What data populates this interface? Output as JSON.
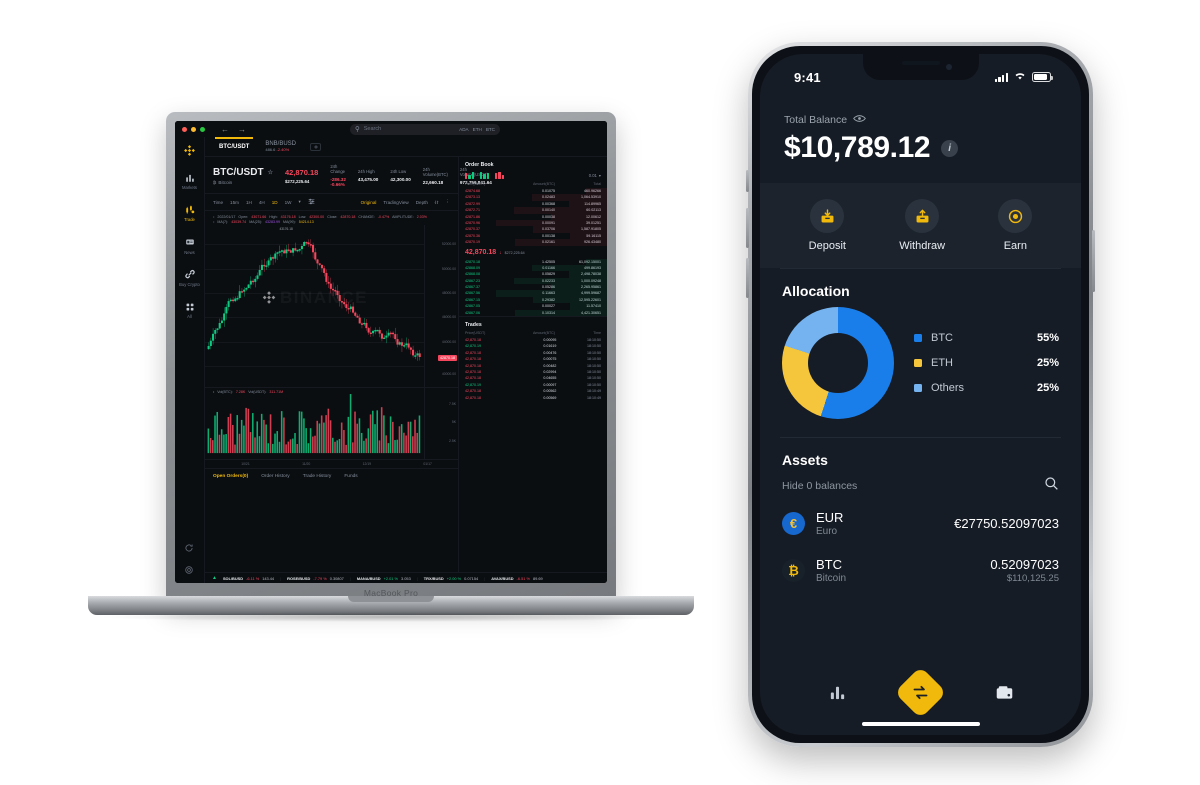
{
  "laptop": {
    "model_label": "MacBook Pro",
    "search": {
      "placeholder": "Search",
      "chips": [
        "ADA",
        "ETH",
        "BTC"
      ]
    },
    "sidebar": {
      "items": [
        {
          "label": "Markets",
          "icon": "bar-chart-icon",
          "active": false
        },
        {
          "label": "Trade",
          "icon": "candlestick-icon",
          "active": true
        },
        {
          "label": "News",
          "icon": "news-icon",
          "active": false
        },
        {
          "label": "Buy\nCrypto",
          "icon": "link-icon",
          "active": false
        },
        {
          "label": "All",
          "icon": "grid-icon",
          "active": false
        }
      ],
      "bottom": [
        {
          "icon": "refresh-icon"
        },
        {
          "icon": "gear-icon"
        }
      ]
    },
    "pair_tabs": [
      {
        "name": "BTC/USDT",
        "sub": "",
        "sub_change": "",
        "active": true
      },
      {
        "name": "BNB/BUSD",
        "sub": "486.6",
        "sub_change": "-2.40%",
        "active": false
      }
    ],
    "ticker": {
      "pair": "BTC/USDT",
      "coin_label": "Bitcoin",
      "last_price": "42,870.18",
      "last_price_usd": "$272,225.64",
      "stats": [
        {
          "label": "24h Change",
          "value": "-286.32 -0.66%",
          "negative": true
        },
        {
          "label": "24h High",
          "value": "43,475.00",
          "negative": false
        },
        {
          "label": "24h Low",
          "value": "42,300.00",
          "negative": false
        },
        {
          "label": "24h Volume(BTC)",
          "value": "22,660.18",
          "negative": false
        },
        {
          "label": "24h Volume(USDT)",
          "value": "972,756,841.64",
          "negative": false
        }
      ]
    },
    "chart": {
      "timeframes": [
        "Time",
        "15m",
        "1H",
        "4H",
        "1D",
        "1W"
      ],
      "active_timeframe": "1D",
      "view_modes": [
        "Original",
        "TradingView",
        "Depth"
      ],
      "active_view": "Original",
      "ohlc_line": {
        "date": "2022/01/17",
        "open_label": "Open:",
        "open": "43071.66",
        "high_label": "High:",
        "high": "43176.18",
        "low_label": "Low:",
        "low": "42300.00",
        "close_label": "Close:",
        "close": "42870.18",
        "change_label": "CHANGE:",
        "change": "-0.47%",
        "amplitude_label": "AMPLITUDE:",
        "amplitude": "2.03%"
      },
      "ma_line": {
        "ma7_label": "MA(7):",
        "ma7": "43039.74",
        "ma25_label": "MA(25):",
        "ma25": "43283.99",
        "ma99_label": "MA(99):",
        "ma99": "54214.13"
      },
      "high_marker": "43176.18",
      "y_ticks": [
        "52000.00",
        "50000.00",
        "48000.00",
        "46000.00",
        "44000.00",
        "42000.00",
        "40000.00"
      ],
      "price_badge": "42870.18",
      "x_ticks": [
        "10/21",
        "11/20",
        "12/19",
        "01/17"
      ],
      "volume_header": {
        "vol_btc_label": "Vol(BTC):",
        "vol_btc": "7.28K",
        "vol_usdt_label": "Vol(USDT):",
        "vol_usdt": "311.71M"
      },
      "volume_y_ticks": [
        "7.5K",
        "5K",
        "2.5K"
      ]
    },
    "order_book": {
      "title": "Order Book",
      "tick_size": "0.01",
      "columns": [
        "Price(USDT)",
        "Amount(BTC)",
        "Total"
      ],
      "asks": [
        {
          "price": "42874.68",
          "amount": "0.01075",
          "total": "460.96266"
        },
        {
          "price": "42873.13",
          "amount": "0.02483",
          "total": "1,064.53910"
        },
        {
          "price": "42872.99",
          "amount": "0.00368",
          "total": "114.89965"
        },
        {
          "price": "42872.71",
          "amount": "0.00140",
          "total": "60.02113"
        },
        {
          "price": "42871.86",
          "amount": "0.00038",
          "total": "12.00612"
        },
        {
          "price": "42870.96",
          "amount": "0.00091",
          "total": "39.01251"
        },
        {
          "price": "42870.37",
          "amount": "0.03706",
          "total": "1,587.91805"
        },
        {
          "price": "42870.36",
          "amount": "0.00138",
          "total": "59.16115"
        },
        {
          "price": "42870.19",
          "amount": "0.02161",
          "total": "926.43480"
        }
      ],
      "mid": {
        "price": "42,870.18",
        "arrow": "↓",
        "usd": "$272,225.64"
      },
      "bids": [
        {
          "price": "42870.18",
          "amount": "1.42505",
          "total": "61,092.15001"
        },
        {
          "price": "42868.09",
          "amount": "0.01166",
          "total": "499.86193"
        },
        {
          "price": "42868.08",
          "amount": "0.05829",
          "total": "2,498.78038"
        },
        {
          "price": "42867.23",
          "amount": "0.02233",
          "total": "1,000.09248"
        },
        {
          "price": "42867.37",
          "amount": "0.05286",
          "total": "2,265.95861"
        },
        {
          "price": "42867.56",
          "amount": "0.11663",
          "total": "4,999.59687"
        },
        {
          "price": "42867.15",
          "amount": "0.29382",
          "total": "12,595.22601"
        },
        {
          "price": "42867.05",
          "amount": "0.00027",
          "total": "11.57410"
        },
        {
          "price": "42867.06",
          "amount": "0.10314",
          "total": "4,421.30651"
        }
      ]
    },
    "trades": {
      "title": "Trades",
      "columns": [
        "Price(USDT)",
        "Amount(BTC)",
        "Time"
      ],
      "rows": [
        {
          "price": "42,870.18",
          "amount": "0.00095",
          "time": "18:10:50",
          "dir": "dn"
        },
        {
          "price": "42,870.19",
          "amount": "0.01619",
          "time": "18:10:50",
          "dir": "up"
        },
        {
          "price": "42,870.18",
          "amount": "0.00476",
          "time": "18:10:50",
          "dir": "dn"
        },
        {
          "price": "42,870.18",
          "amount": "0.00075",
          "time": "18:10:50",
          "dir": "dn"
        },
        {
          "price": "42,870.18",
          "amount": "0.00482",
          "time": "18:10:50",
          "dir": "dn"
        },
        {
          "price": "42,870.18",
          "amount": "0.02994",
          "time": "18:10:50",
          "dir": "dn"
        },
        {
          "price": "42,870.18",
          "amount": "0.04655",
          "time": "18:10:50",
          "dir": "dn"
        },
        {
          "price": "42,870.19",
          "amount": "0.00097",
          "time": "18:10:50",
          "dir": "up"
        },
        {
          "price": "42,870.18",
          "amount": "0.00562",
          "time": "18:10:49",
          "dir": "dn"
        },
        {
          "price": "42,870.18",
          "amount": "0.00569",
          "time": "18:10:49",
          "dir": "dn"
        }
      ]
    },
    "order_tabs": [
      {
        "label": "Open Orders(0)",
        "active": true
      },
      {
        "label": "Order History",
        "active": false
      },
      {
        "label": "Trade History",
        "active": false
      },
      {
        "label": "Funds",
        "active": false
      }
    ],
    "market_strip": [
      {
        "symbol": "SOL/BUSD",
        "change": "-6.11 %",
        "price": "143.44",
        "dir": "dn"
      },
      {
        "symbol": "ROSE/BUSD",
        "change": "-7.79 %",
        "price": "0.30807",
        "dir": "dn"
      },
      {
        "symbol": "MANA/BUSD",
        "change": "+2.01 %",
        "price": "3.053",
        "dir": "up"
      },
      {
        "symbol": "TRX/BUSD",
        "change": "+2.00 %",
        "price": "0.07154",
        "dir": "up"
      },
      {
        "symbol": "AVAX/BUSD",
        "change": "-6.51 %",
        "price": "89.69",
        "dir": "dn"
      }
    ]
  },
  "phone": {
    "status": {
      "time": "9:41",
      "signal_icon": "cellular-bars-icon",
      "wifi_icon": "wifi-icon",
      "battery_icon": "battery-icon"
    },
    "balance": {
      "label": "Total Balance",
      "eye_icon": "eye-icon",
      "amount": "$10,789.12",
      "info_icon": "info-icon"
    },
    "actions": [
      {
        "label": "Deposit",
        "icon": "deposit-icon"
      },
      {
        "label": "Withdraw",
        "icon": "withdraw-icon"
      },
      {
        "label": "Earn",
        "icon": "earn-icon"
      }
    ],
    "allocation": {
      "title": "Allocation",
      "colors": {
        "btc": "#1a7eea",
        "eth": "#f5c53c",
        "others": "#74b3f0"
      }
    },
    "assets": {
      "title": "Assets",
      "hide_label": "Hide 0 balances",
      "search_icon": "search-icon",
      "rows": [
        {
          "symbol": "EUR",
          "name": "Euro",
          "glyph": "€",
          "value": "€27750.52097023",
          "subvalue": ""
        },
        {
          "symbol": "BTC",
          "name": "Bitcoin",
          "glyph": "₿",
          "value": "0.52097023",
          "subvalue": "$110,125.25"
        }
      ]
    },
    "tabbar": [
      {
        "icon": "chart-icon",
        "active": false
      },
      {
        "icon": "swap-icon",
        "active": true
      },
      {
        "icon": "wallet-icon",
        "active": false
      }
    ]
  },
  "chart_data": {
    "type": "pie",
    "title": "Allocation",
    "categories": [
      "BTC",
      "ETH",
      "Others"
    ],
    "values": [
      55,
      25,
      25
    ],
    "labels": [
      "55%",
      "25%",
      "25%"
    ],
    "colors": [
      "#1a7eea",
      "#f5c53c",
      "#74b3f0"
    ],
    "legend_position": "right",
    "donut": true
  }
}
